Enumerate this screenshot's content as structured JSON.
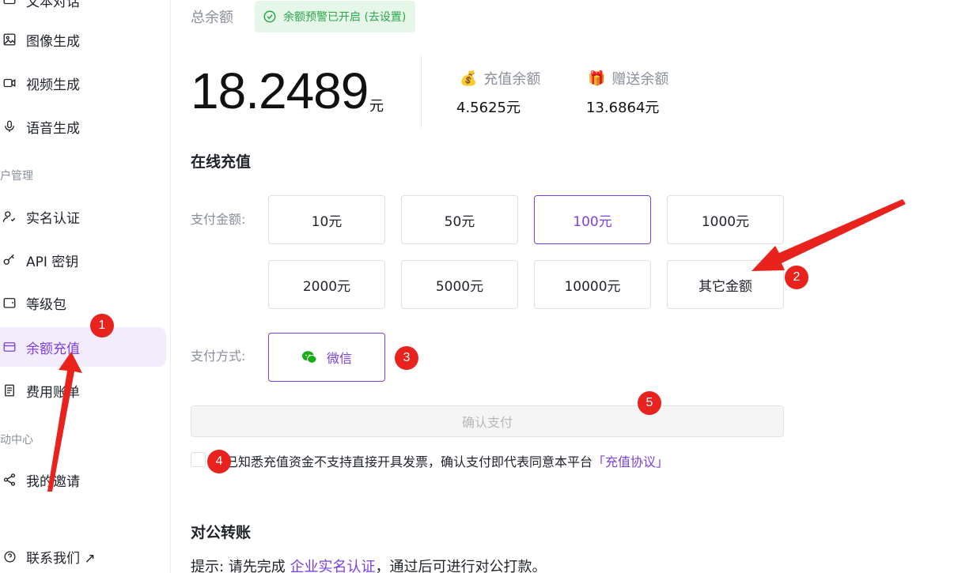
{
  "sidebar": {
    "items": [
      {
        "label": "文本对话",
        "icon": "chat-icon"
      },
      {
        "label": "图像生成",
        "icon": "image-icon"
      },
      {
        "label": "视频生成",
        "icon": "video-icon"
      },
      {
        "label": "语音生成",
        "icon": "mic-icon"
      },
      {
        "label": "实名认证",
        "icon": "user-check-icon"
      },
      {
        "label": "API 密钥",
        "icon": "key-icon"
      },
      {
        "label": "等级包",
        "icon": "wallet-icon"
      },
      {
        "label": "余额充值",
        "icon": "card-icon"
      },
      {
        "label": "费用账单",
        "icon": "bill-icon"
      },
      {
        "label": "我的邀请",
        "icon": "share-icon"
      },
      {
        "label": "联系我们 ↗",
        "icon": "help-icon"
      }
    ],
    "groups": [
      "户管理",
      "动中心"
    ],
    "active": "余额充值"
  },
  "balance": {
    "total_label": "总余额",
    "warning_badge": "余额预警已开启 (去设置)",
    "total_amount": "18.2489",
    "unit": "元",
    "recharge_label": "充值余额",
    "recharge_value": "4.5625元",
    "gift_label": "赠送余额",
    "gift_value": "13.6864元"
  },
  "recharge": {
    "section_title": "在线充值",
    "amount_label": "支付金额:",
    "amounts": [
      "10元",
      "50元",
      "100元",
      "1000元",
      "2000元",
      "5000元",
      "10000元",
      "其它金额"
    ],
    "selected_amount": "100元",
    "method_label": "支付方式:",
    "method": "微信",
    "confirm_label": "确认支付",
    "agreement_text": "已知悉充值资金不支持直接开具发票，确认支付即代表同意本平台",
    "agreement_link": "「充值协议」"
  },
  "transfer": {
    "section_title": "对公转账",
    "tip_prefix": "提示: 请先完成",
    "tip_link": "企业实名认证",
    "tip_suffix": "，通过后可进行对公打款。"
  },
  "annotations": [
    "1",
    "2",
    "3",
    "4",
    "5"
  ],
  "colors": {
    "accent": "#7b3fe4",
    "success": "#2aa84a",
    "marker": "#e8231d"
  }
}
